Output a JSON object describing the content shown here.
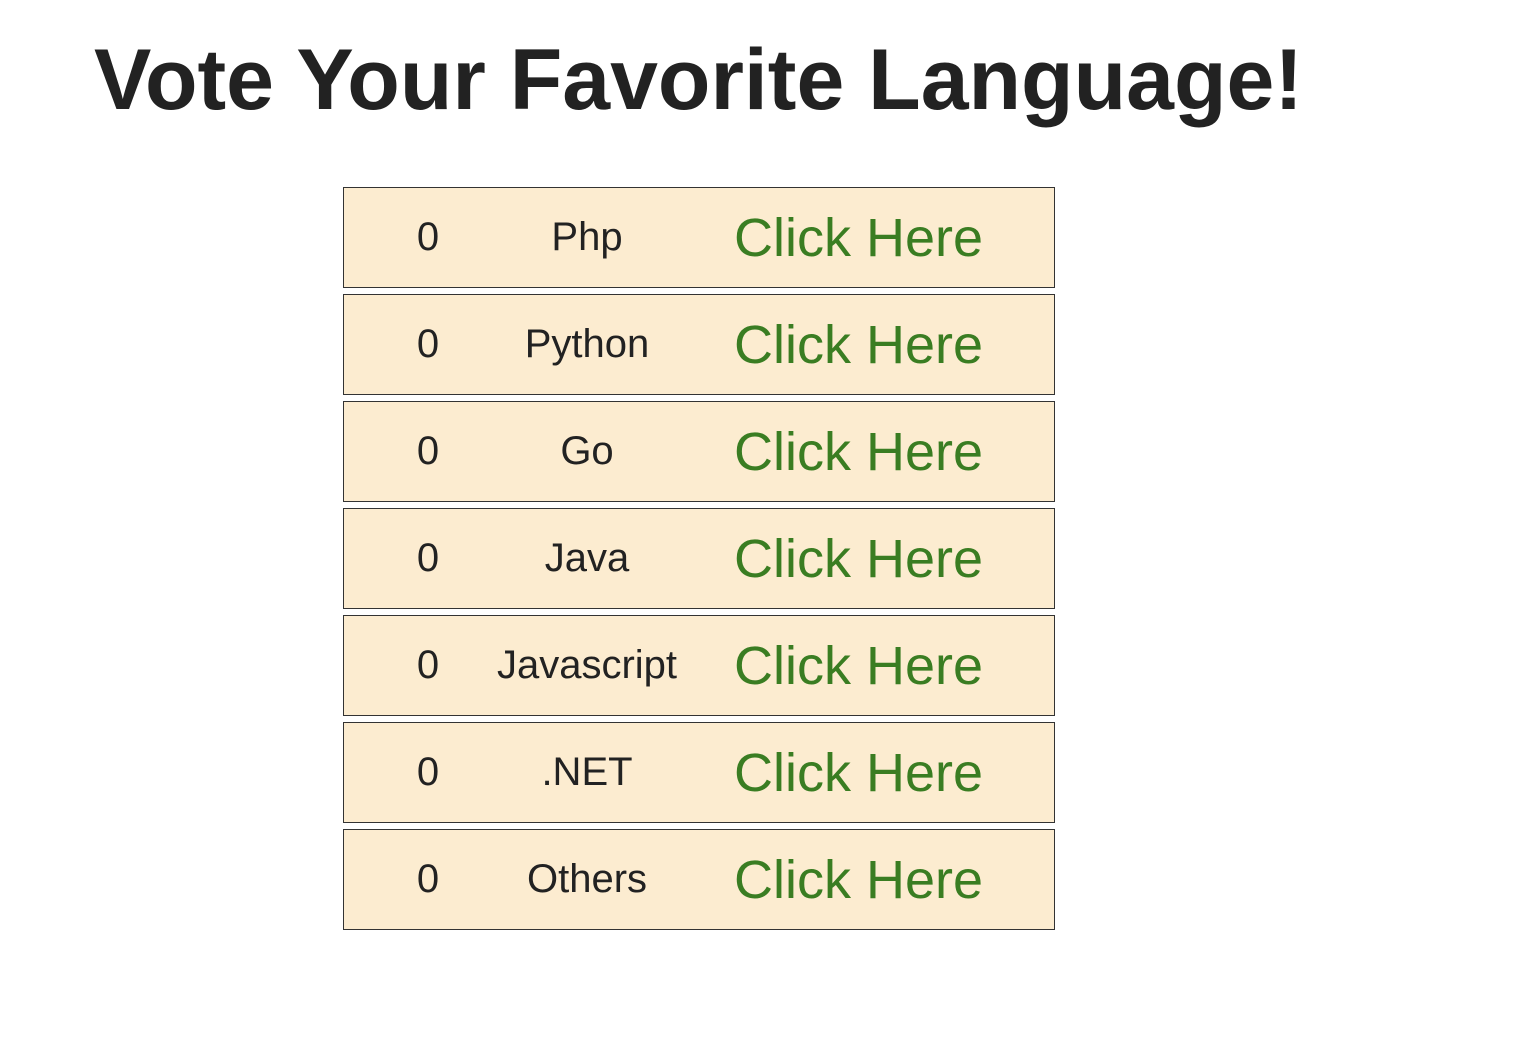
{
  "page": {
    "title": "Vote Your Favorite Language!"
  },
  "colors": {
    "row_background": "#fcecd0",
    "link": "#3a7d22",
    "text": "#222222"
  },
  "languages": [
    {
      "count": "0",
      "name": "Php",
      "action": "Click Here"
    },
    {
      "count": "0",
      "name": "Python",
      "action": "Click Here"
    },
    {
      "count": "0",
      "name": "Go",
      "action": "Click Here"
    },
    {
      "count": "0",
      "name": "Java",
      "action": "Click Here"
    },
    {
      "count": "0",
      "name": "Javascript",
      "action": "Click Here"
    },
    {
      "count": "0",
      "name": ".NET",
      "action": "Click Here"
    },
    {
      "count": "0",
      "name": "Others",
      "action": "Click Here"
    }
  ]
}
